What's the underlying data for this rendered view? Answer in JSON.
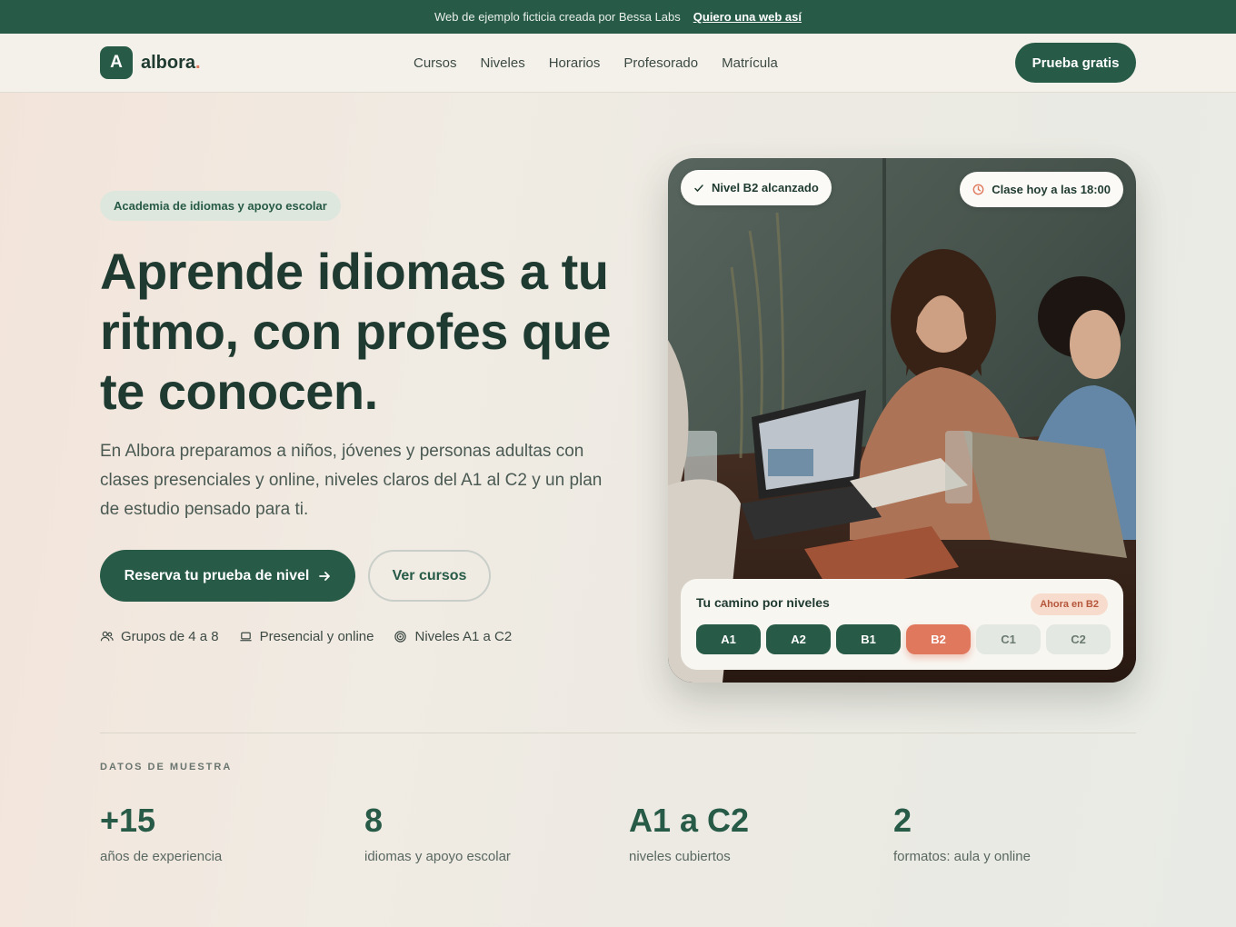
{
  "topbar": {
    "text": "Web de ejemplo ficticia creada por Bessa Labs",
    "link": "Quiero una web así"
  },
  "brand": {
    "mark": "A",
    "name": "albora",
    "dot": "."
  },
  "nav": {
    "items": [
      {
        "label": "Cursos"
      },
      {
        "label": "Niveles"
      },
      {
        "label": "Horarios"
      },
      {
        "label": "Profesorado"
      },
      {
        "label": "Matrícula"
      }
    ],
    "cta": "Prueba gratis"
  },
  "hero": {
    "badge": "Academia de idiomas y apoyo escolar",
    "title": "Aprende idiomas a tu ritmo, con profes que te conocen.",
    "description": "En Albora preparamos a niños, jóvenes y personas adultas con clases presenciales y online, niveles claros del A1 al C2 y un plan de estudio pensado para ti.",
    "primary_button": "Reserva tu prueba de nivel",
    "secondary_button": "Ver cursos",
    "features": [
      {
        "icon": "group-icon",
        "label": "Grupos de 4 a 8"
      },
      {
        "icon": "laptop-icon",
        "label": "Presencial y online"
      },
      {
        "icon": "target-icon",
        "label": "Niveles A1 a C2"
      }
    ]
  },
  "card": {
    "pill_left": "Nivel B2 alcanzado",
    "pill_right": "Clase hoy a las 18:00",
    "panel_title": "Tu camino por niveles",
    "current_badge": "Ahora en B2",
    "levels": [
      {
        "label": "A1",
        "state": "done"
      },
      {
        "label": "A2",
        "state": "done"
      },
      {
        "label": "B1",
        "state": "done"
      },
      {
        "label": "B2",
        "state": "current"
      },
      {
        "label": "C1",
        "state": "future"
      },
      {
        "label": "C2",
        "state": "future"
      }
    ]
  },
  "stats": {
    "label": "DATOS DE MUESTRA",
    "items": [
      {
        "value": "+15",
        "label": "años de experiencia"
      },
      {
        "value": "8",
        "label": "idiomas y apoyo escolar"
      },
      {
        "value": "A1 a C2",
        "label": "niveles cubiertos"
      },
      {
        "value": "2",
        "label": "formatos: aula y online"
      }
    ]
  },
  "colors": {
    "brand_green": "#275a47",
    "accent_coral": "#e0785e",
    "text_dark": "#1f3a30"
  }
}
